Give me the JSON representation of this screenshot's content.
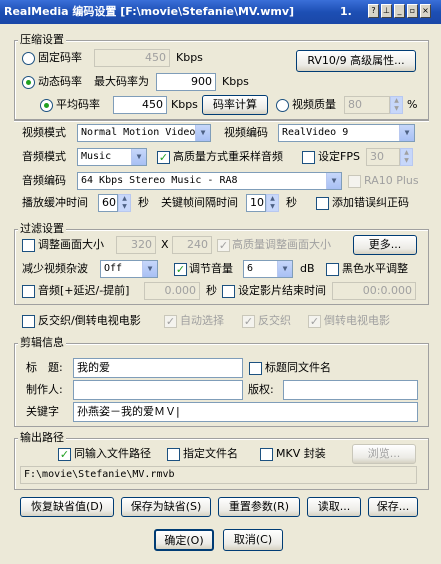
{
  "window": {
    "title": "RealMedia 编码设置 [F:\\movie\\Stefanie\\MV.wmv]",
    "controls": [
      "_",
      "▫",
      "×"
    ]
  },
  "compression": {
    "legend": "压缩设置",
    "cbr_label": "固定码率",
    "cbr_value": "450",
    "cbr_unit": "Kbps",
    "vbr_label": "动态码率",
    "max_label": "最大码率为",
    "max_value": "900",
    "max_unit": "Kbps",
    "rv_button": "RV10/9 高级属性...",
    "avg_label": "平均码率",
    "avg_value": "450",
    "avg_unit": "Kbps",
    "calc_button": "码率计算",
    "quality_label": "视频质量",
    "quality_value": "80",
    "quality_unit": "%"
  },
  "video": {
    "mode_label": "视频模式",
    "mode_value": "Normal Motion Video",
    "codec_label": "视频编码",
    "codec_value": "RealVideo 9"
  },
  "audio": {
    "mode_label": "音频模式",
    "mode_value": "Music",
    "hq_resample": "高质量方式重采样音频",
    "fps_label": "设定FPS",
    "fps_value": "30",
    "codec_label": "音频编码",
    "codec_value": "64 Kbps Stereo Music - RA8",
    "ra10": "RA10 Plus"
  },
  "buffer": {
    "label": "播放缓冲时间",
    "value": "60",
    "unit": "秒",
    "keyframe_label": "关键帧间隔时间",
    "keyframe_value": "10",
    "keyframe_unit": "秒",
    "ecc": "添加错误纠正码"
  },
  "filter": {
    "legend": "过滤设置",
    "resize": "调整画面大小",
    "w": "320",
    "x": "X",
    "h": "240",
    "hq_resize": "高质量调整画面大小",
    "more_button": "更多...",
    "denoise_label": "减少视频杂波",
    "denoise_value": "Off",
    "volume": "调节音量",
    "volume_value": "6",
    "volume_unit": "dB",
    "black": "黑色水平调整",
    "audio_delay": "音频[+延迟/-提前]",
    "delay_value": "0.000",
    "delay_unit": "秒",
    "end_time": "设定影片结束时间",
    "end_value": "00:0.000"
  },
  "deinterlace": {
    "main": "反交织/倒转电视电影",
    "auto": "自动选择",
    "deint": "反交织",
    "telecine": "倒转电视电影"
  },
  "clip": {
    "legend": "剪辑信息",
    "title_label": "标　题:",
    "title_value": "我的爱",
    "same_name": "标题同文件名",
    "author_label": "制作人:",
    "author_value": "",
    "copyright_label": "版权:",
    "copyright_value": "",
    "keywords_label": "关键字",
    "keywords_value": "孙燕姿－我的爱ＭＶ|"
  },
  "output": {
    "legend": "输出路径",
    "same_path": "同输入文件路径",
    "named": "指定文件名",
    "mkv": "MKV 封装",
    "browse": "浏览...",
    "path": "F:\\movie\\Stefanie\\MV.rmvb"
  },
  "buttons": {
    "restore": "恢复缺省值(D)",
    "save_default": "保存为缺省(S)",
    "reset": "重置参数(R)",
    "read": "读取...",
    "save": "保存...",
    "ok": "确定(O)",
    "cancel": "取消(C)"
  }
}
